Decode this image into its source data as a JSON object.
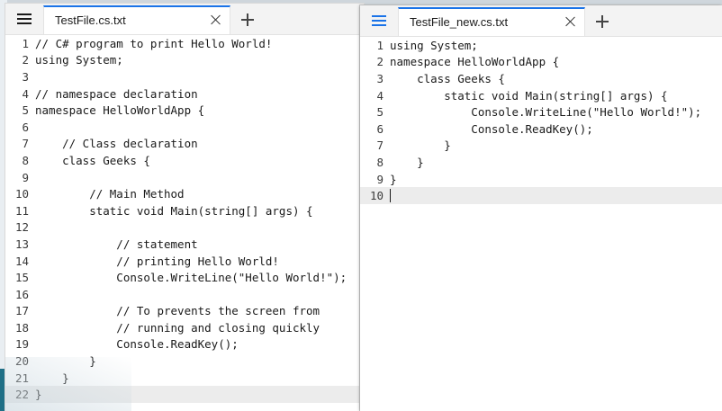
{
  "left_window": {
    "tab_title": "TestFile.cs.txt",
    "lines": [
      "// C# program to print Hello World!",
      "using System;",
      "",
      "// namespace declaration",
      "namespace HelloWorldApp {",
      "",
      "    // Class declaration",
      "    class Geeks {",
      "",
      "        // Main Method",
      "        static void Main(string[] args) {",
      "",
      "            // statement",
      "            // printing Hello World!",
      "            Console.WriteLine(\"Hello World!\");",
      "",
      "            // To prevents the screen from",
      "            // running and closing quickly",
      "            Console.ReadKey();",
      "        }",
      "    }",
      "}"
    ],
    "current_line": 22
  },
  "right_window": {
    "tab_title": "TestFile_new.cs.txt",
    "lines": [
      "using System;",
      "namespace HelloWorldApp {",
      "    class Geeks {",
      "        static void Main(string[] args) {",
      "            Console.WriteLine(\"Hello World!\");",
      "            Console.ReadKey();",
      "        }",
      "    }",
      "}",
      ""
    ],
    "current_line": 10
  },
  "colors": {
    "accent": "#1a73e8",
    "current_line": "#ececec"
  },
  "icons": {
    "menu": "hamburger-icon",
    "close": "close-icon",
    "new_tab": "plus-icon"
  }
}
